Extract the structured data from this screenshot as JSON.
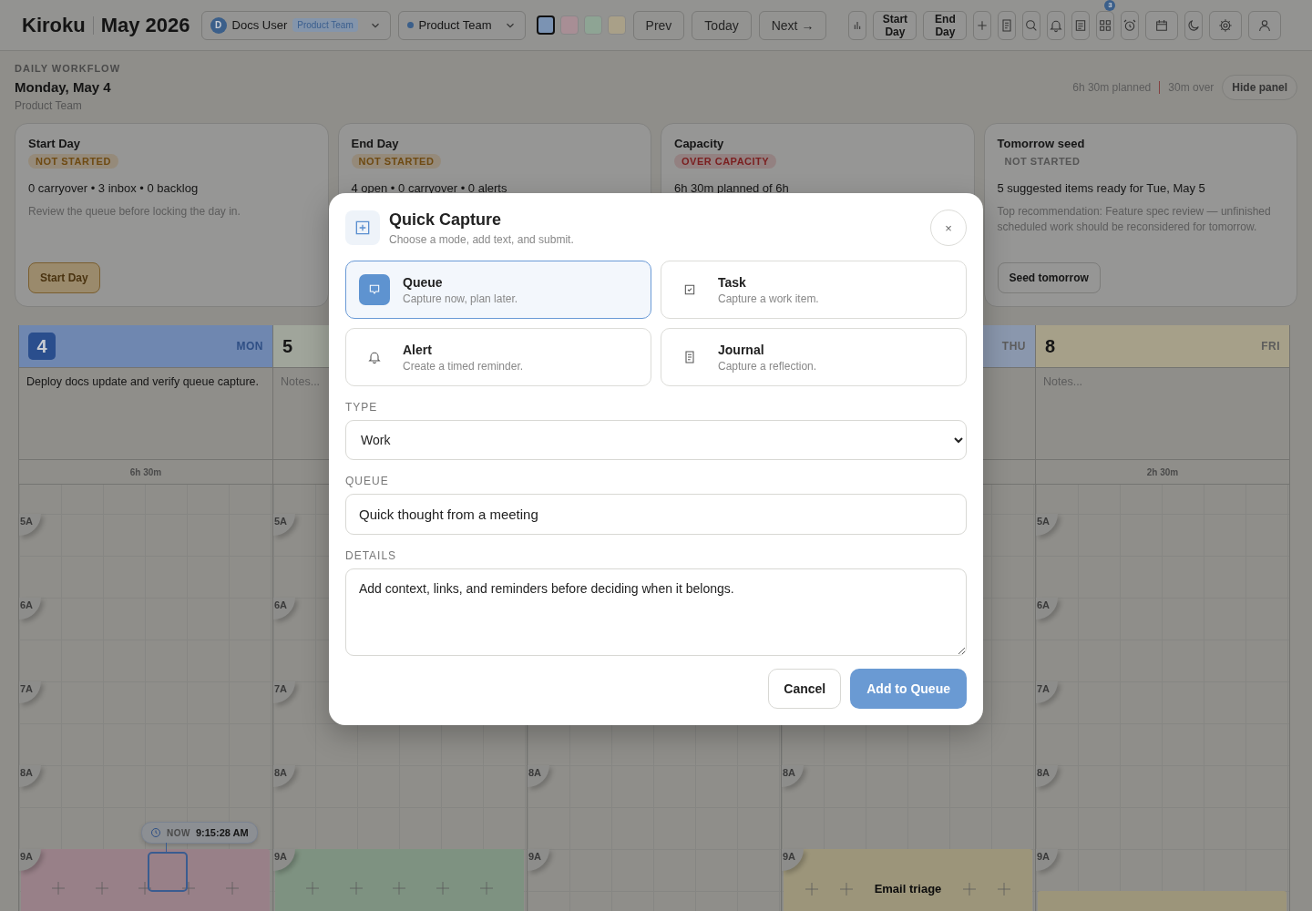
{
  "header": {
    "logo": "Kiroku",
    "title": "May 2026",
    "user_select": {
      "avatar": "D",
      "name": "Docs User",
      "badge": "Product Team"
    },
    "team_select": {
      "label": "Product Team"
    },
    "swatches": [
      {
        "color": "#7b93b3",
        "selected": true
      },
      {
        "color": "#a88e95",
        "selected": false
      },
      {
        "color": "#8ea494",
        "selected": false
      },
      {
        "color": "#a9a088",
        "selected": false
      }
    ],
    "nav": [
      "Prev",
      "Today",
      "Next →"
    ],
    "toolbar": [
      {
        "kind": "chart"
      },
      {
        "kind": "text",
        "label": "Start Day"
      },
      {
        "kind": "text",
        "label": "End Day"
      },
      {
        "kind": "plus"
      },
      {
        "kind": "doc"
      },
      {
        "kind": "search"
      },
      {
        "kind": "bell"
      },
      {
        "kind": "list"
      },
      {
        "kind": "grid",
        "badge": "3"
      },
      {
        "kind": "alarm"
      },
      {
        "kind": "calendar"
      },
      {
        "kind": "moon"
      },
      {
        "kind": "gear"
      },
      {
        "kind": "user"
      }
    ]
  },
  "panel": {
    "eyebrow": "DAILY WORKFLOW",
    "date": "Monday, May 4",
    "team": "Product Team",
    "planned": "6h 30m planned",
    "over": "30m over",
    "hide_button": "Hide panel"
  },
  "cards": [
    {
      "title": "Start Day",
      "status": {
        "text": "NOT STARTED",
        "kind": "warning"
      },
      "summary": "0 carryover • 3 inbox • 0 backlog",
      "note": "Review the queue before locking the day in.",
      "button": {
        "label": "Start Day",
        "kind": "warning"
      }
    },
    {
      "title": "End Day",
      "status": {
        "text": "NOT STARTED",
        "kind": "warning"
      },
      "summary": "4 open • 0 carryover • 0 alerts"
    },
    {
      "title": "Capacity",
      "status": {
        "text": "OVER CAPACITY",
        "kind": "danger"
      },
      "summary": "6h 30m planned of 6h"
    },
    {
      "title": "Tomorrow seed",
      "status": {
        "text": "NOT STARTED",
        "kind": "neutral"
      },
      "summary": "5 suggested items ready for Tue, May 5",
      "note": "Top recommendation: Feature spec review — unfinished scheduled work should be reconsidered for tomorrow.",
      "button": {
        "label": "Seed tomorrow",
        "kind": "default"
      }
    }
  ],
  "days": [
    {
      "number": "4",
      "weekday": "MON",
      "today": true,
      "color": "#6f87b0",
      "notes": "Deploy docs update and verify queue capture.",
      "planned": "6h 30m",
      "hours": [
        "5A",
        "6A",
        "7A",
        "8A",
        "9A"
      ],
      "events": [
        {
          "color": "#988088"
        }
      ]
    },
    {
      "number": "5",
      "today": false,
      "color": "#a0a59b",
      "notes_placeholder": "Notes...",
      "hours": [
        "5A",
        "6A",
        "7A",
        "8A",
        "9A"
      ],
      "events": [
        {
          "color": "#7e9281"
        }
      ]
    },
    {
      "hours": [
        "8A",
        "9A"
      ]
    },
    {
      "weekday": "THU",
      "color": "#8a97ad",
      "hours": [
        "8A",
        "9A"
      ],
      "events": [
        {
          "color": "#9c957a",
          "title": "Email triage"
        }
      ]
    },
    {
      "number": "8",
      "weekday": "FRI",
      "today": false,
      "color": "#a6a089",
      "notes_placeholder": "Notes...",
      "planned": "2h 30m",
      "hours": [
        "5A",
        "6A",
        "7A",
        "8A",
        "9A"
      ],
      "events": [
        {
          "color": "#9c957a",
          "starts_on_half_hour": true
        }
      ]
    }
  ],
  "now": {
    "label": "NOW",
    "time": "9:15:28 AM"
  },
  "modal": {
    "title": "Quick Capture",
    "subtitle": "Choose a mode, add text, and submit.",
    "close": "×",
    "modes": [
      {
        "kind": "queue",
        "title": "Queue",
        "desc": "Capture now, plan later.",
        "selected": true
      },
      {
        "kind": "task",
        "title": "Task",
        "desc": "Capture a work item.",
        "selected": false
      },
      {
        "kind": "alert",
        "title": "Alert",
        "desc": "Create a timed reminder.",
        "selected": false
      },
      {
        "kind": "journal",
        "title": "Journal",
        "desc": "Capture a reflection.",
        "selected": false
      }
    ],
    "type_label": "TYPE",
    "type_value": "Work",
    "queue_label": "QUEUE",
    "queue_value": "Quick thought from a meeting",
    "details_label": "DETAILS",
    "details_value": "Add context, links, and reminders before deciding when it belongs.",
    "cancel": "Cancel",
    "submit": "Add to Queue"
  }
}
